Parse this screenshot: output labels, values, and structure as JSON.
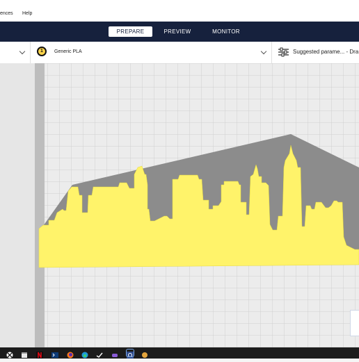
{
  "menubar": {
    "items": [
      "ences",
      "Help"
    ]
  },
  "stages": [
    {
      "label": "PREPARE",
      "active": true
    },
    {
      "label": "PREVIEW",
      "active": false
    },
    {
      "label": "MONITOR",
      "active": false
    }
  ],
  "toolbar": {
    "extruder_number": "1",
    "material": "Generic PLA",
    "print_settings": "Suggested parame... - Dra"
  },
  "colors": {
    "stage_bar": "#16213d",
    "model_yellow": "#fff36a",
    "model_shadow": "#8c8c8c",
    "build_plate": "#ececec",
    "grid_line": "#cfcfcf"
  },
  "taskbar": {
    "icons": [
      "windows-icon",
      "xbox-icon",
      "file-explorer-icon",
      "netflix-icon",
      "terminal-icon",
      "firefox-icon",
      "edge-icon",
      "steam-icon",
      "game-icon",
      "cura-icon",
      "app-icon"
    ]
  }
}
